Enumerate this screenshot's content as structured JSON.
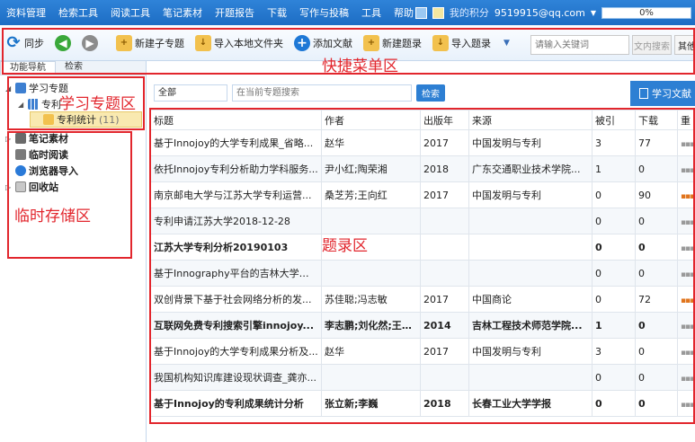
{
  "menubar": {
    "items": [
      "资料管理",
      "检索工具",
      "阅读工具",
      "笔记素材",
      "开题报告",
      "下载",
      "写作与投稿",
      "工具",
      "帮助"
    ],
    "credit_label": "我的积分",
    "account": "9519915@qq.com",
    "progress": 0,
    "progress_text": "0%"
  },
  "toolbar": {
    "sync": "同步",
    "new_subject": "新建子专题",
    "import_folder": "导入本地文件夹",
    "add_doc": "添加文献",
    "new_record": "新建题录",
    "import_record": "导入题录",
    "keyword_placeholder": "请输入关键词",
    "text_search": "文内搜索",
    "other": "其他"
  },
  "left": {
    "tabs": [
      "功能导航",
      "检索"
    ],
    "tree": {
      "root": "学习专题",
      "child": "专利",
      "leaf": "专利统计",
      "leaf_count": "(11)",
      "others": [
        "笔记素材",
        "临时阅读",
        "浏览器导入",
        "回收站"
      ]
    }
  },
  "annotations": {
    "quick_menu": "快捷菜单区",
    "subject": "学习专题区",
    "temp": "临时存储区",
    "records": "题录区"
  },
  "main": {
    "filter": "全部",
    "search_placeholder": "在当前专题搜索",
    "search_button": "检索",
    "learn_button": "学习文献",
    "columns": [
      "标题",
      "作者",
      "出版年",
      "来源",
      "被引",
      "下载",
      "重"
    ],
    "rows": [
      {
        "title": "基于Innojoy的大学专利成果_省略...",
        "author": "赵华",
        "year": "2017",
        "source": "中国发明与专利",
        "cited": "3",
        "download": "77",
        "bold": false,
        "hot": false
      },
      {
        "title": "依托Innojoy专利分析助力学科服务...",
        "author": "尹小红;陶荣湘",
        "year": "2018",
        "source": "广东交通职业技术学院...",
        "cited": "1",
        "download": "0",
        "bold": false,
        "hot": false
      },
      {
        "title": "南京邮电大学与江苏大学专利运营...",
        "author": "桑芝芳;王向红",
        "year": "2017",
        "source": "中国发明与专利",
        "cited": "0",
        "download": "90",
        "bold": false,
        "hot": true
      },
      {
        "title": "专利申请江苏大学2018-12-28",
        "author": "",
        "year": "",
        "source": "",
        "cited": "0",
        "download": "0",
        "bold": false,
        "hot": false
      },
      {
        "title": "江苏大学专利分析20190103",
        "author": "",
        "year": "",
        "source": "",
        "cited": "0",
        "download": "0",
        "bold": true,
        "hot": false
      },
      {
        "title": "基于Innography平台的吉林大学专...",
        "author": "",
        "year": "",
        "source": "",
        "cited": "0",
        "download": "0",
        "bold": false,
        "hot": false
      },
      {
        "title": "双创背景下基于社会网络分析的发...",
        "author": "苏佳聪;冯志敏",
        "year": "2017",
        "source": "中国商论",
        "cited": "0",
        "download": "72",
        "bold": false,
        "hot": true
      },
      {
        "title": "互联网免费专利搜索引擎innojoy...",
        "author": "李志鹏;刘化然;王涛...",
        "year": "2014",
        "source": "吉林工程技术师范学院...",
        "cited": "1",
        "download": "0",
        "bold": true,
        "hot": false
      },
      {
        "title": "基于Innojoy的大学专利成果分析及...",
        "author": "赵华",
        "year": "2017",
        "source": "中国发明与专利",
        "cited": "3",
        "download": "0",
        "bold": false,
        "hot": false
      },
      {
        "title": "我国机构知识库建设现状调查_龚亦...",
        "author": "",
        "year": "",
        "source": "",
        "cited": "0",
        "download": "0",
        "bold": false,
        "hot": false
      },
      {
        "title": "基于Innojoy的专利成果统计分析",
        "author": "张立新;李巍",
        "year": "2018",
        "source": "长春工业大学学报",
        "cited": "0",
        "download": "0",
        "bold": true,
        "hot": false
      }
    ]
  },
  "colors": {
    "accent": "#2d7fd3",
    "annotation": "#e2262d",
    "selected": "#f9e9b0"
  }
}
